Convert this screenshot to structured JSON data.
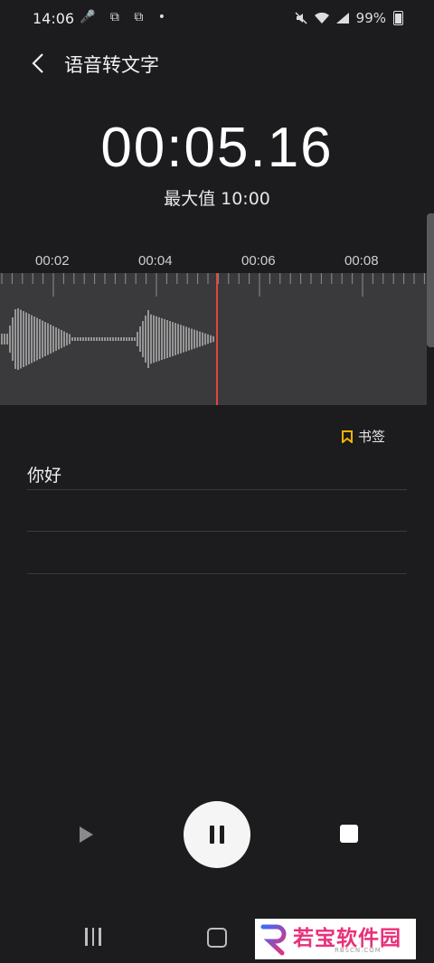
{
  "status_bar": {
    "time": "14:06",
    "left_icons": "🎤 ⧉ ⧉ •",
    "battery_percent": "99%"
  },
  "header": {
    "title": "语音转文字",
    "back_icon": "chevron-left-icon"
  },
  "recording": {
    "elapsed": "00:05.16",
    "max_label": "最大值 10:00"
  },
  "timeline": {
    "ticks": [
      "00:02",
      "00:04",
      "00:06",
      "00:08"
    ],
    "playhead_color": "#e0463c"
  },
  "bookmark": {
    "label": "书签",
    "icon_color": "#f5b400"
  },
  "transcript": {
    "lines": [
      "你好",
      "",
      ""
    ]
  },
  "controls": {
    "play_icon": "play-icon",
    "pause_icon": "pause-icon",
    "stop_icon": "stop-icon"
  },
  "watermark": {
    "name": "若宝软件园",
    "sub": "RBSCN.COM"
  }
}
